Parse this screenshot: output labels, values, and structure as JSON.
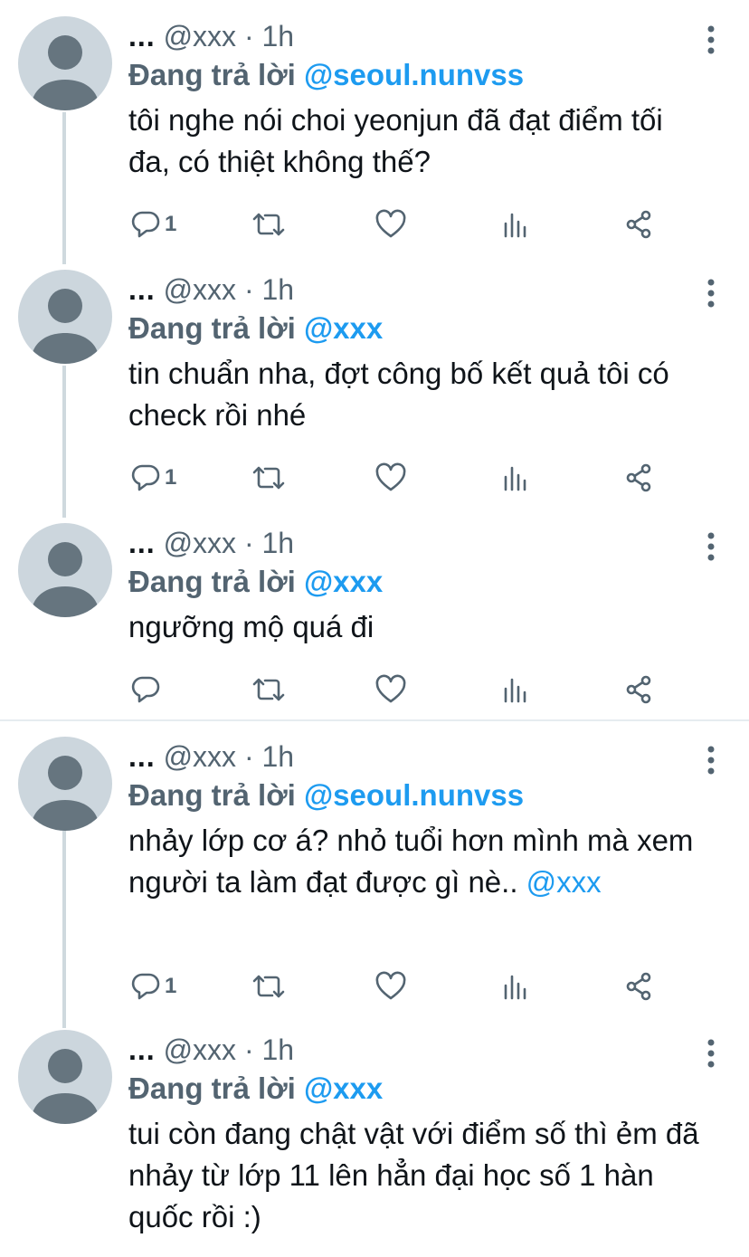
{
  "colors": {
    "accent": "#1d9bf0",
    "secondary_text": "#536471",
    "primary_text": "#0f1419",
    "avatar_bg": "#ccd6dd",
    "avatar_fg": "#66757f"
  },
  "icons": [
    "reply-icon",
    "retweet-icon",
    "like-icon",
    "views-icon",
    "share-icon",
    "more-icon"
  ],
  "tweets": [
    {
      "dots": "...",
      "handle": "@xxx",
      "sep": "·",
      "time": "1h",
      "reply_prefix": "Đang trả lời",
      "reply_to": "@seoul.nunvss",
      "text": "tôi nghe nói choi yeonjun đã đạt điểm tối đa, có thiệt không thế?",
      "text_mention": "",
      "reply_count": "1"
    },
    {
      "dots": "...",
      "handle": "@xxx",
      "sep": "·",
      "time": "1h",
      "reply_prefix": "Đang trả lời",
      "reply_to": "@xxx",
      "text": "tin chuẩn nha, đợt công bố kết quả tôi có check rồi nhé",
      "text_mention": "",
      "reply_count": "1"
    },
    {
      "dots": "...",
      "handle": "@xxx",
      "sep": "·",
      "time": "1h",
      "reply_prefix": "Đang trả lời",
      "reply_to": "@xxx",
      "text": "ngưỡng mộ quá đi",
      "text_mention": "",
      "reply_count": ""
    },
    {
      "dots": "...",
      "handle": "@xxx",
      "sep": "·",
      "time": "1h",
      "reply_prefix": "Đang trả lời",
      "reply_to": "@seoul.nunvss",
      "text": "nhảy lớp cơ á? nhỏ tuổi hơn mình mà xem người ta làm đạt được gì nè..",
      "text_mention": "@xxx",
      "reply_count": "1"
    },
    {
      "dots": "...",
      "handle": "@xxx",
      "sep": "·",
      "time": "1h",
      "reply_prefix": "Đang trả lời",
      "reply_to": "@xxx",
      "text": "tui còn đang chật vật với điểm số thì ẻm đã nhảy từ lớp 11 lên hẳn đại học số 1 hàn quốc rồi :)",
      "text_mention": "",
      "reply_count": ""
    }
  ]
}
